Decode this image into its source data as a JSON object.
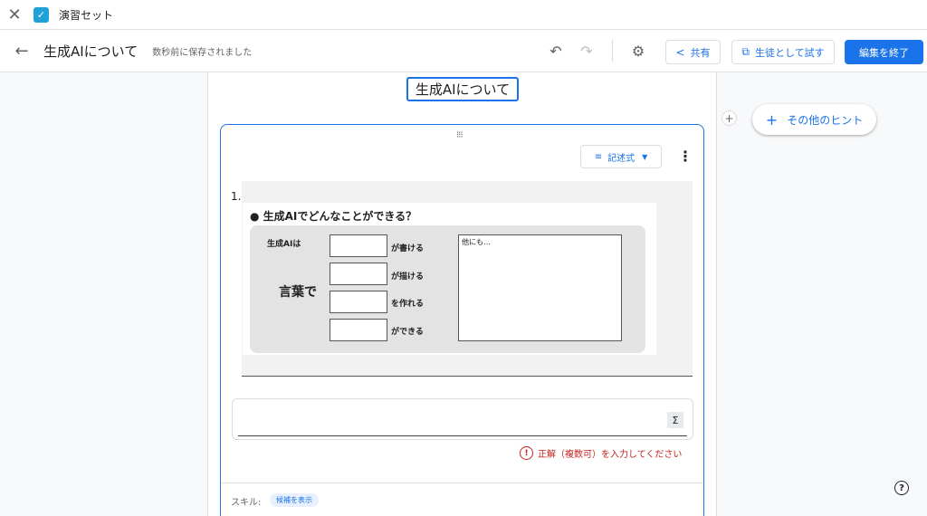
{
  "app": {
    "title": "演習セット"
  },
  "header": {
    "doc_title": "生成AIについて",
    "saved_status": "数秒前に保存されました",
    "share_label": "共有",
    "try_as_student_label": "生徒として試す",
    "finish_edit_label": "編集を終了"
  },
  "content": {
    "title": "生成AIについて",
    "question": {
      "number": "1.",
      "type_label": "記述式",
      "image": {
        "heading": "● 生成AIでどんなことができる？",
        "label_ai": "生成AIは",
        "label_kotoba": "言葉で",
        "blank_labels": [
          "が書ける",
          "が描ける",
          "を作れる",
          "ができる"
        ],
        "other_box_label": "他にも…"
      },
      "sigma_label": "Σ",
      "error_text": "正解（複数可）を入力してください"
    },
    "skill": {
      "label": "スキル:",
      "chip": "候補を表示"
    }
  },
  "side": {
    "hint_label": "その他のヒント"
  },
  "colors": {
    "accent": "#1a73e8",
    "error": "#c5221f",
    "app_icon": "#1fa2d8"
  },
  "icons": {
    "close": "close-icon",
    "app": "app-check-icon",
    "back": "arrow-back-icon",
    "undo": "undo-icon",
    "redo": "redo-icon",
    "settings": "gear-icon",
    "share": "share-icon",
    "open": "open-in-new-icon",
    "drag": "drag-handle-icon",
    "short_text": "short-text-icon",
    "more": "more-vert-icon",
    "plus": "plus-icon",
    "error": "error-icon",
    "help": "help-icon"
  }
}
